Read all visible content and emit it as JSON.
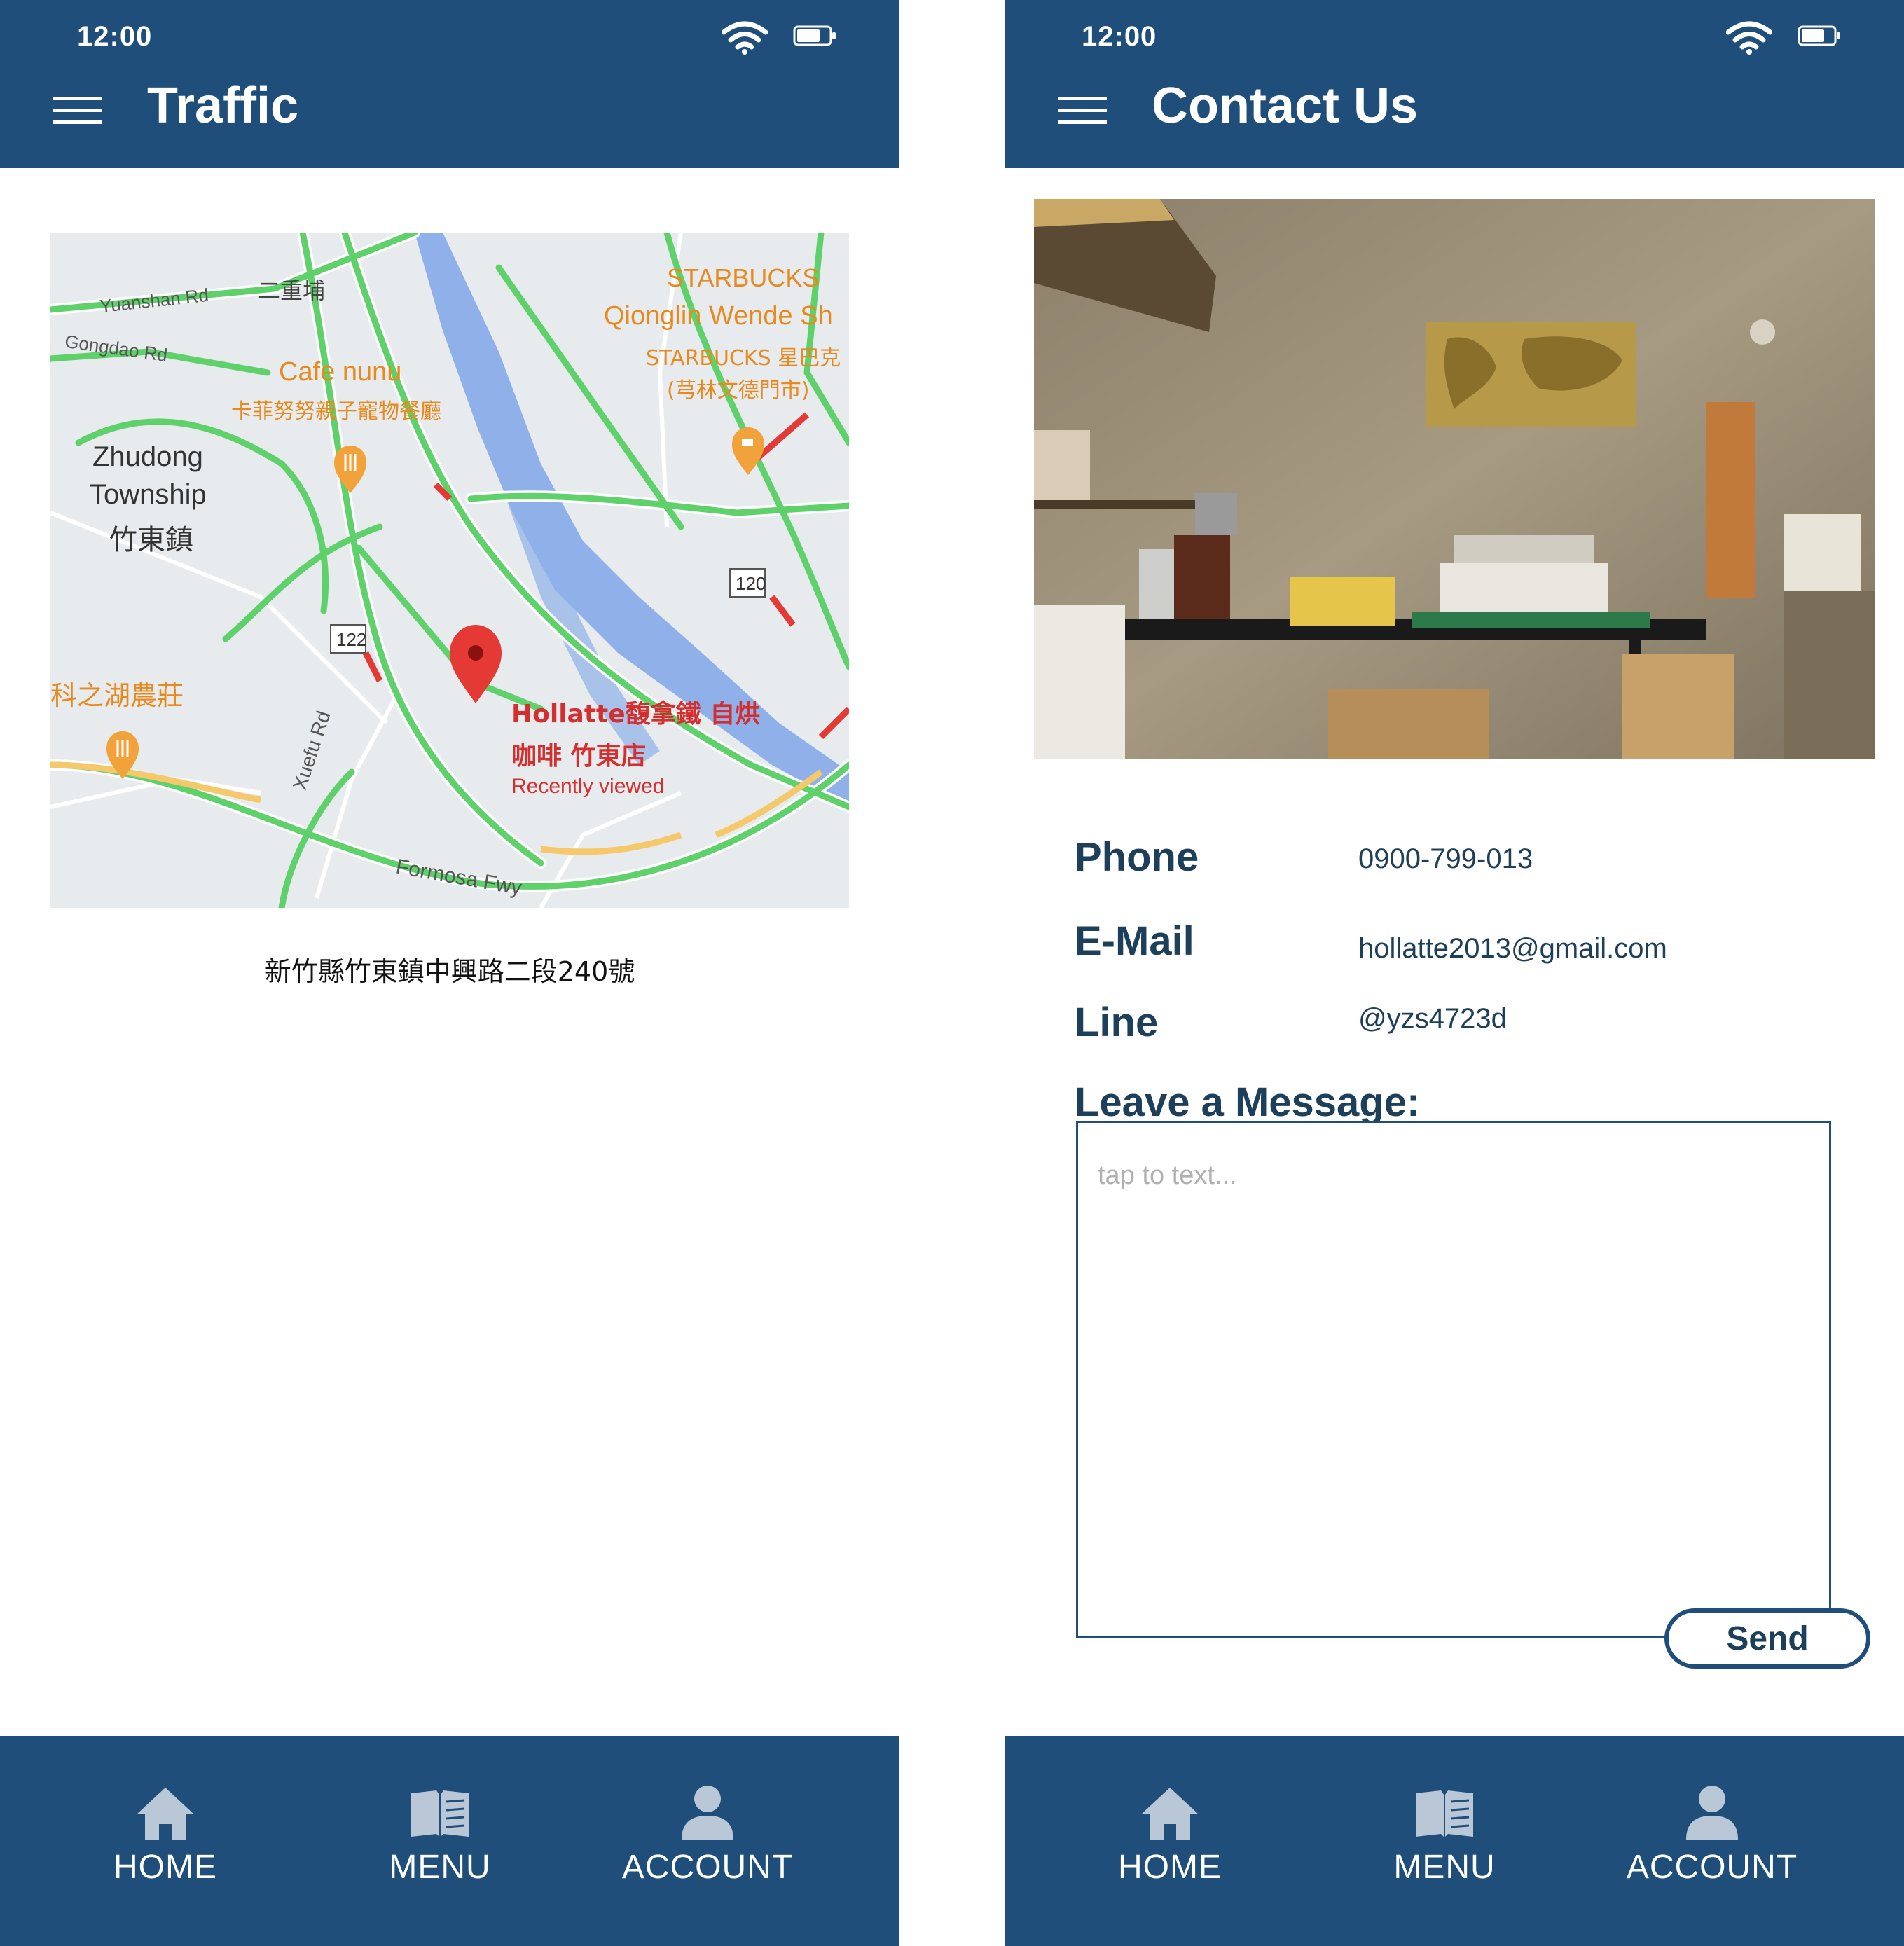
{
  "status_bar": {
    "time": "12:00"
  },
  "traffic": {
    "title": "Traffic",
    "map": {
      "labels": {
        "yuanshan_rd": "Yuanshan Rd",
        "erchongpu": "二重埔",
        "gongdao_rd": "Gongdao Rd",
        "starbucks": "STARBUCKS",
        "qionglin": "Qionglin Wende Sh",
        "starbucks_cn": "STARBUCKS 星巴克",
        "starbucks_cn2": "(芎林文德門市)",
        "cafe_nunu": "Cafe nunu",
        "cafe_nunu_cn": "卡菲努努親子寵物餐廳",
        "zhudong": "Zhudong",
        "township": "Township",
        "zhudong_cn": "竹東鎮",
        "route_120": "120",
        "route_122": "122",
        "kezhihu": "科之湖農莊",
        "hollatte_1": "Hollatte馥拿鐵 自烘",
        "hollatte_2": "咖啡 竹東店",
        "recently_viewed": "Recently viewed",
        "xuefu_rd": "Xuefu Rd",
        "formosa_fwy": "Formosa Fwy"
      }
    },
    "address": "新竹縣竹東鎮中興路二段240號"
  },
  "contact": {
    "title": "Contact Us",
    "phone_label": "Phone",
    "phone_value": "0900-799-013",
    "email_label": "E-Mail",
    "email_value": "hollatte2013@gmail.com",
    "line_label": "Line",
    "line_value": "@yzs4723d",
    "message_label": "Leave a Message:",
    "message_placeholder": "tap to text...",
    "send_label": "Send"
  },
  "nav": {
    "home": "HOME",
    "menu": "MENU",
    "account": "ACCOUNT"
  },
  "colors": {
    "brand": "#1e4e79",
    "text_dark": "#1e3f5a",
    "traffic_green": "#5fd16a",
    "traffic_orange": "#f2a23a",
    "traffic_red": "#e53935",
    "water": "#7fa6e6"
  },
  "icons": [
    "hamburger-menu-icon",
    "wifi-icon",
    "battery-icon",
    "home-icon",
    "book-icon",
    "person-icon",
    "map-pin-icon"
  ]
}
